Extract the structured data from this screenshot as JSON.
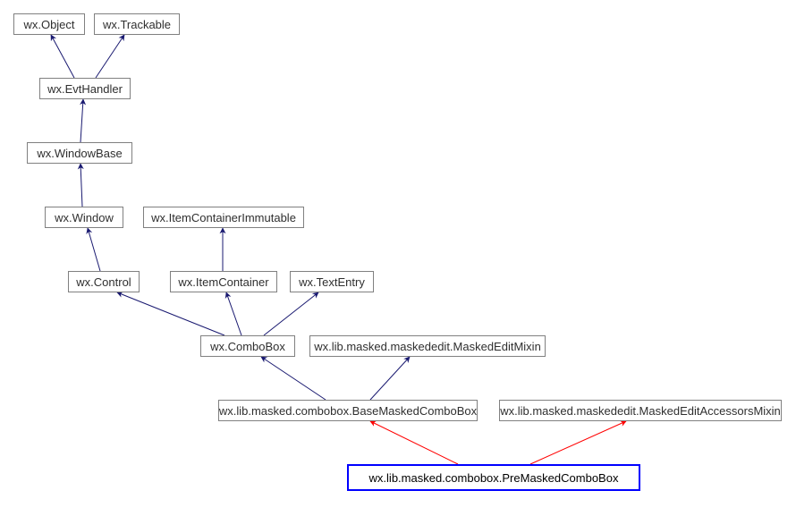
{
  "chart_data": {
    "type": "class-inheritance",
    "nodes": {
      "object": {
        "label": "wx.Object"
      },
      "trackable": {
        "label": "wx.Trackable"
      },
      "evthandler": {
        "label": "wx.EvtHandler"
      },
      "windowbase": {
        "label": "wx.WindowBase"
      },
      "window": {
        "label": "wx.Window"
      },
      "itemimm": {
        "label": "wx.ItemContainerImmutable"
      },
      "control": {
        "label": "wx.Control"
      },
      "itemcontainer": {
        "label": "wx.ItemContainer"
      },
      "textentry": {
        "label": "wx.TextEntry"
      },
      "combobox": {
        "label": "wx.ComboBox"
      },
      "meditmixin": {
        "label": "wx.lib.masked.maskededit.MaskedEditMixin"
      },
      "basecombo": {
        "label": "wx.lib.masked.combobox.BaseMaskedComboBox"
      },
      "accessors": {
        "label": "wx.lib.masked.maskededit.MaskedEditAccessorsMixin"
      },
      "precombo": {
        "label": "wx.lib.masked.combobox.PreMaskedComboBox"
      }
    },
    "edges": [
      {
        "child": "evthandler",
        "parent": "object",
        "kind": "base"
      },
      {
        "child": "evthandler",
        "parent": "trackable",
        "kind": "base"
      },
      {
        "child": "windowbase",
        "parent": "evthandler",
        "kind": "base"
      },
      {
        "child": "window",
        "parent": "windowbase",
        "kind": "base"
      },
      {
        "child": "control",
        "parent": "window",
        "kind": "base"
      },
      {
        "child": "itemcontainer",
        "parent": "itemimm",
        "kind": "base"
      },
      {
        "child": "combobox",
        "parent": "control",
        "kind": "base"
      },
      {
        "child": "combobox",
        "parent": "itemcontainer",
        "kind": "base"
      },
      {
        "child": "combobox",
        "parent": "textentry",
        "kind": "base"
      },
      {
        "child": "basecombo",
        "parent": "combobox",
        "kind": "base"
      },
      {
        "child": "basecombo",
        "parent": "meditmixin",
        "kind": "base"
      },
      {
        "child": "precombo",
        "parent": "basecombo",
        "kind": "derived"
      },
      {
        "child": "precombo",
        "parent": "accessors",
        "kind": "derived"
      }
    ],
    "colors": {
      "base_edge": "#191970",
      "derived_edge": "#ff0000",
      "focus_border": "#0000ff",
      "node_border": "#808080"
    }
  }
}
